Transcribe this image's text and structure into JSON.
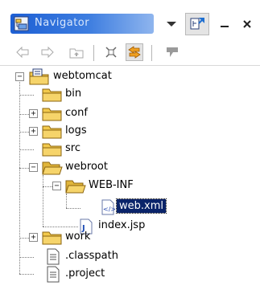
{
  "window": {
    "title": "Navigator",
    "icons": {
      "title": "navigator-view-icon",
      "view_menu": "view-menu-icon",
      "focus": "focus-on-active-task-icon",
      "minimize": "minimize-icon",
      "close": "close-icon"
    }
  },
  "toolbar": {
    "back": "back-arrow-icon",
    "forward": "forward-arrow-icon",
    "up": "up-folder-icon",
    "collapse_all": "collapse-all-icon",
    "link_with_editor": "link-with-editor-icon",
    "filter": "filter-icon"
  },
  "tree": {
    "project": "webtomcat",
    "bin": "bin",
    "conf": "conf",
    "logs": "logs",
    "src": "src",
    "webroot": "webroot",
    "webinf": "WEB-INF",
    "webxml": "web.xml",
    "indexjsp": "index.jsp",
    "work": "work",
    "classpath": ".classpath",
    "project_file": ".project"
  },
  "colors": {
    "title_bar": "#1d5fd4",
    "selection": "#0a246a",
    "folder": "#f2c94c"
  }
}
